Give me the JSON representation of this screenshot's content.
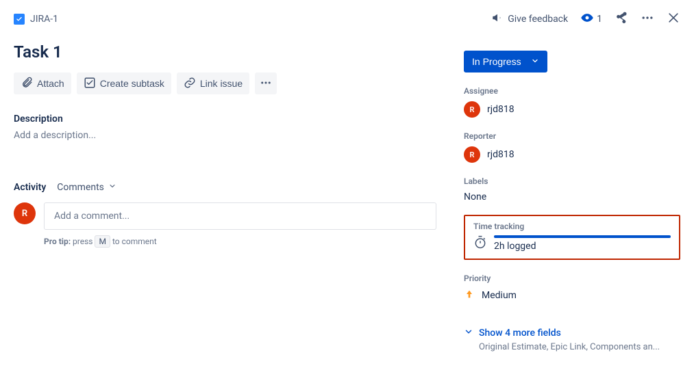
{
  "breadcrumb": {
    "key": "JIRA-1"
  },
  "title": "Task 1",
  "actions": {
    "attach": "Attach",
    "create_subtask": "Create subtask",
    "link_issue": "Link issue"
  },
  "description": {
    "label": "Description",
    "placeholder": "Add a description..."
  },
  "activity": {
    "label": "Activity",
    "tab": "Comments",
    "comment_placeholder": "Add a comment...",
    "protip_prefix": "Pro tip:",
    "protip_text_before": " press ",
    "protip_key": "M",
    "protip_text_after": " to comment"
  },
  "header_actions": {
    "feedback": "Give feedback",
    "watch_count": "1"
  },
  "status": {
    "label": "In Progress"
  },
  "fields": {
    "assignee": {
      "label": "Assignee",
      "value": "rjd818",
      "initial": "R"
    },
    "reporter": {
      "label": "Reporter",
      "value": "rjd818",
      "initial": "R"
    },
    "labels": {
      "label": "Labels",
      "value": "None"
    },
    "time_tracking": {
      "label": "Time tracking",
      "logged": "2h logged"
    },
    "priority": {
      "label": "Priority",
      "value": "Medium"
    },
    "more_fields": {
      "label": "Show 4 more fields",
      "sub": "Original Estimate, Epic Link, Components an..."
    }
  },
  "current_user_initial": "R"
}
